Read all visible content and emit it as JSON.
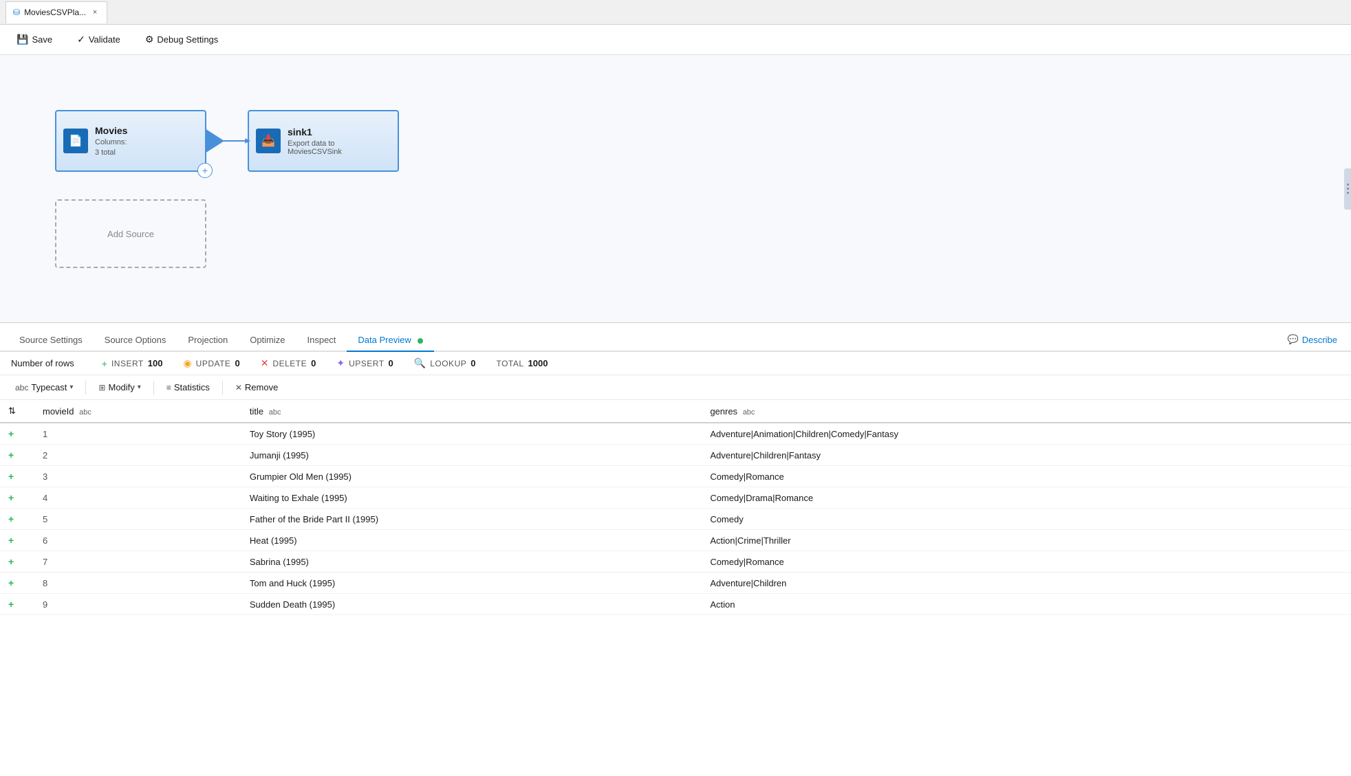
{
  "titleBar": {
    "tabLabel": "MoviesCSVPla...",
    "closeLabel": "×",
    "icon": "⛁"
  },
  "toolbar": {
    "saveLabel": "Save",
    "validateLabel": "Validate",
    "debugSettingsLabel": "Debug Settings",
    "settingsIcon": "⚙"
  },
  "pipeline": {
    "sourceNode": {
      "name": "Movies",
      "icon": "📄",
      "columnsLabel": "Columns:",
      "columnsValue": "3 total"
    },
    "sinkNode": {
      "name": "sink1",
      "icon": "📥",
      "description": "Export data to MoviesCSVSink"
    },
    "addSourceLabel": "Add Source"
  },
  "tabs": {
    "items": [
      {
        "id": "source-settings",
        "label": "Source Settings",
        "active": false
      },
      {
        "id": "source-options",
        "label": "Source Options",
        "active": false
      },
      {
        "id": "projection",
        "label": "Projection",
        "active": false
      },
      {
        "id": "optimize",
        "label": "Optimize",
        "active": false
      },
      {
        "id": "inspect",
        "label": "Inspect",
        "active": false
      },
      {
        "id": "data-preview",
        "label": "Data Preview",
        "active": true
      }
    ],
    "describeLabel": "Describe"
  },
  "statsBar": {
    "numRowsLabel": "Number of rows",
    "insert": {
      "label": "INSERT",
      "value": "100"
    },
    "update": {
      "label": "UPDATE",
      "value": "0"
    },
    "delete": {
      "label": "DELETE",
      "value": "0"
    },
    "upsert": {
      "label": "UPSERT",
      "value": "0"
    },
    "lookup": {
      "label": "LOOKUP",
      "value": "0"
    },
    "total": {
      "label": "TOTAL",
      "value": "1000"
    }
  },
  "dataToolbar": {
    "typecastLabel": "Typecast",
    "typecastIcon": "abc",
    "modifyLabel": "Modify",
    "modifyIcon": "⊞",
    "statisticsLabel": "Statistics",
    "statisticsIcon": "≡",
    "removeLabel": "Remove",
    "removeIcon": "×"
  },
  "tableColumns": [
    {
      "id": "sort",
      "label": "",
      "type": ""
    },
    {
      "id": "movieId",
      "label": "movieId",
      "type": "abc"
    },
    {
      "id": "title",
      "label": "title",
      "type": "abc"
    },
    {
      "id": "genres",
      "label": "genres",
      "type": "abc"
    }
  ],
  "tableRows": [
    {
      "marker": "+",
      "movieId": "1",
      "title": "Toy Story (1995)",
      "genres": "Adventure|Animation|Children|Comedy|Fantasy"
    },
    {
      "marker": "+",
      "movieId": "2",
      "title": "Jumanji (1995)",
      "genres": "Adventure|Children|Fantasy"
    },
    {
      "marker": "+",
      "movieId": "3",
      "title": "Grumpier Old Men (1995)",
      "genres": "Comedy|Romance"
    },
    {
      "marker": "+",
      "movieId": "4",
      "title": "Waiting to Exhale (1995)",
      "genres": "Comedy|Drama|Romance"
    },
    {
      "marker": "+",
      "movieId": "5",
      "title": "Father of the Bride Part II (1995)",
      "genres": "Comedy"
    },
    {
      "marker": "+",
      "movieId": "6",
      "title": "Heat (1995)",
      "genres": "Action|Crime|Thriller"
    },
    {
      "marker": "+",
      "movieId": "7",
      "title": "Sabrina (1995)",
      "genres": "Comedy|Romance"
    },
    {
      "marker": "+",
      "movieId": "8",
      "title": "Tom and Huck (1995)",
      "genres": "Adventure|Children"
    },
    {
      "marker": "+",
      "movieId": "9",
      "title": "Sudden Death (1995)",
      "genres": "Action"
    }
  ]
}
